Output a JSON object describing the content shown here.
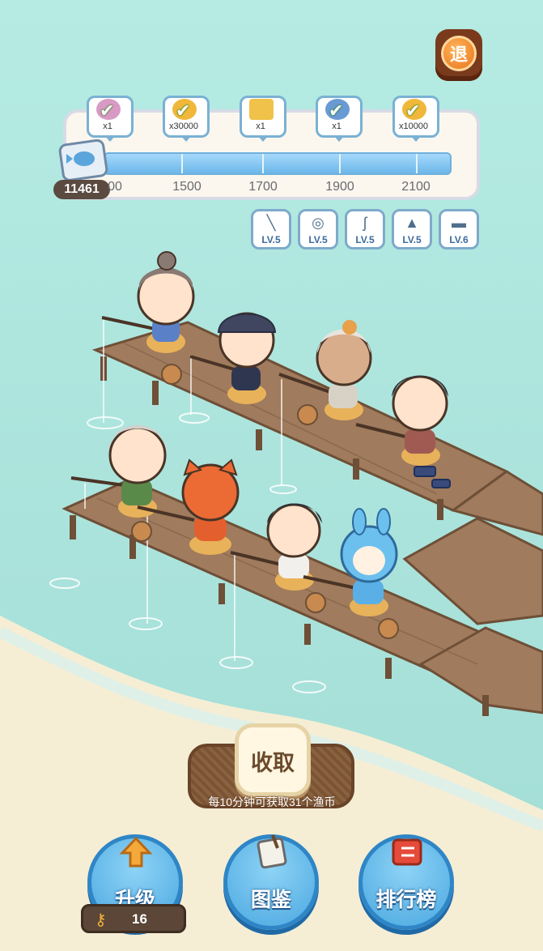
{
  "exit_button": {
    "label": "退"
  },
  "progress": {
    "current_score": "11461",
    "milestones": [
      {
        "value": "1300",
        "shown": "00"
      },
      {
        "value": "1500",
        "shown": "1500"
      },
      {
        "value": "1700",
        "shown": "1700"
      },
      {
        "value": "1900",
        "shown": "1900"
      },
      {
        "value": "2100",
        "shown": "2100"
      }
    ],
    "rewards": [
      {
        "qty": "x1",
        "claimed": true,
        "icon": "gift-icon"
      },
      {
        "qty": "x30000",
        "claimed": true,
        "icon": "coin-icon"
      },
      {
        "qty": "x1",
        "claimed": false,
        "icon": "scroll-icon"
      },
      {
        "qty": "x1",
        "claimed": true,
        "icon": "gift-icon"
      },
      {
        "qty": "x10000",
        "claimed": true,
        "icon": "coin-icon"
      }
    ]
  },
  "tools": [
    {
      "name": "rod-icon",
      "level": "LV.5"
    },
    {
      "name": "reel-icon",
      "level": "LV.5"
    },
    {
      "name": "hook-icon",
      "level": "LV.5"
    },
    {
      "name": "hat-icon",
      "level": "LV.5"
    },
    {
      "name": "boat-icon",
      "level": "LV.6"
    }
  ],
  "collect": {
    "label": "收取",
    "note": "每10分钟可获取31个渔币"
  },
  "bottom_buttons": [
    {
      "label": "升级",
      "icon": "arrow-up-icon"
    },
    {
      "label": "图鉴",
      "icon": "book-icon"
    },
    {
      "label": "排行榜",
      "icon": "rank-icon"
    }
  ],
  "keys": {
    "count": "16"
  },
  "colors": {
    "sea": "#a9e4dc",
    "sand": "#f4ecd2",
    "dock": "#8b6b52",
    "accent_blue": "#4aa8e0"
  }
}
